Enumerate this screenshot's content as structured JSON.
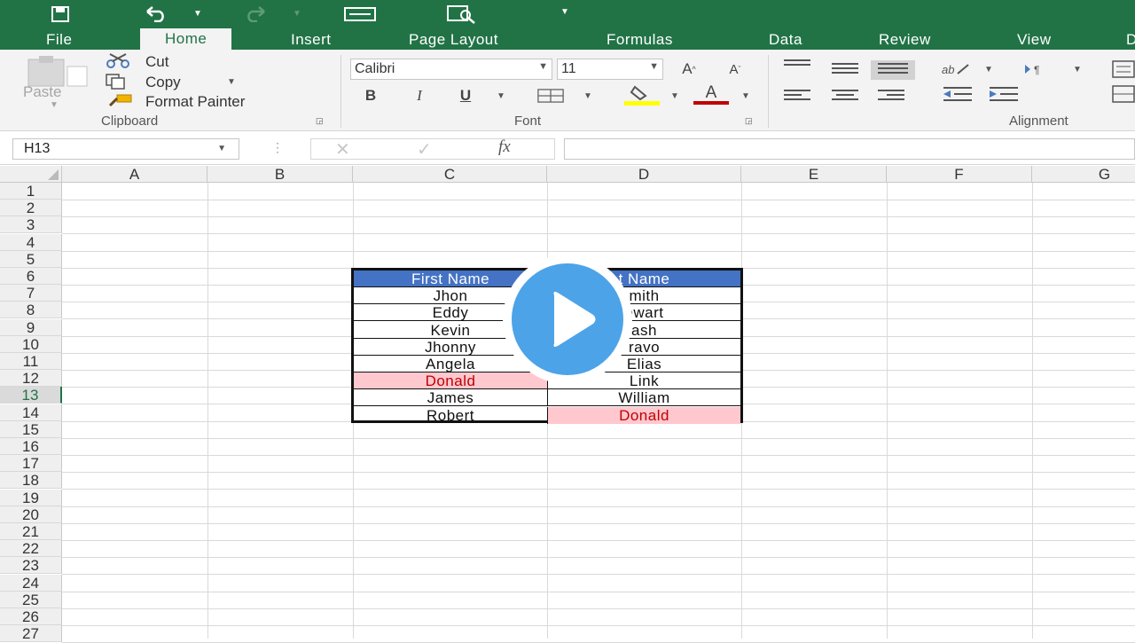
{
  "app": {
    "accent": "#217346"
  },
  "quick_access": {
    "icons": [
      "save-icon",
      "undo-icon",
      "redo-icon",
      "form-icon",
      "print-preview-icon",
      "customize-icon"
    ]
  },
  "tabs": [
    {
      "label": "File"
    },
    {
      "label": "Home"
    },
    {
      "label": "Insert"
    },
    {
      "label": "Page Layout"
    },
    {
      "label": "Formulas"
    },
    {
      "label": "Data"
    },
    {
      "label": "Review"
    },
    {
      "label": "View"
    },
    {
      "label": "D"
    }
  ],
  "ribbon": {
    "clipboard": {
      "paste": "Paste",
      "cut": "Cut",
      "copy": "Copy",
      "format_painter": "Format Painter",
      "label": "Clipboard"
    },
    "font": {
      "family": "Calibri",
      "size": "11",
      "bold": "B",
      "italic": "I",
      "underline": "U",
      "label": "Font",
      "font_color": "A",
      "grow": "A",
      "shrink": "A",
      "highlight_color": "#ffff00",
      "font_color_value": "#c00000"
    },
    "alignment": {
      "label": "Alignment"
    }
  },
  "formula_bar": {
    "name_box": "H13",
    "fx": "fx",
    "value": ""
  },
  "columns": [
    "A",
    "B",
    "C",
    "D",
    "E",
    "F",
    "G"
  ],
  "rows": [
    "1",
    "2",
    "3",
    "4",
    "5",
    "6",
    "7",
    "8",
    "9",
    "10",
    "11",
    "12",
    "13",
    "14",
    "15",
    "16",
    "17",
    "18",
    "19",
    "20",
    "21",
    "22",
    "23",
    "24",
    "25",
    "26",
    "27"
  ],
  "selected_row": "13",
  "table": {
    "headers": [
      "First Name",
      "t Name"
    ],
    "rows": [
      [
        "Jhon",
        "mith"
      ],
      [
        "Eddy",
        "ewart"
      ],
      [
        "Kevin",
        "ash"
      ],
      [
        "Jhonny",
        "ravo"
      ],
      [
        "Angela",
        "Elias"
      ],
      [
        "Donald",
        "Link"
      ],
      [
        "James",
        "William"
      ],
      [
        "Robert",
        "Donald"
      ]
    ],
    "duplicate_color": "#ffc7ce",
    "header_color": "#4472c4"
  },
  "overlay": {
    "icon": "play-icon",
    "color": "#4da3e8"
  }
}
